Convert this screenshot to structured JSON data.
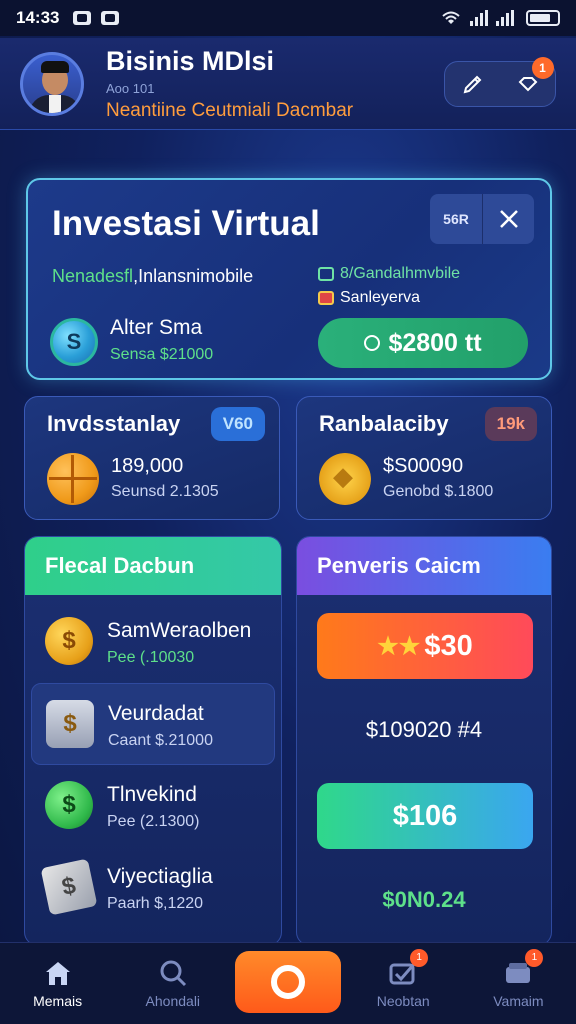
{
  "status_bar": {
    "time": "14:33"
  },
  "header": {
    "title": "Bisinis MDlsi",
    "subtitle": "Aoo 101",
    "tagline": "Neantiine Ceutmiali Dacmbar",
    "notification_count": "1"
  },
  "main_card": {
    "title": "Investasi Virtual",
    "btn_label": "56R",
    "line1_green": "Nenadesfl",
    "line1_white": ",Inlansnimobile",
    "right_line1": "8/Gandalhmvbile",
    "right_line2": "Sanleyerva",
    "item_title": "Alter Sma",
    "item_sub": "Sensa $21000",
    "amount": "$2800 tt",
    "colors": {
      "border": "#5fc8e8",
      "amount_bg": "#2ab07a"
    }
  },
  "mid_cards": [
    {
      "title": "Invdsstanlay",
      "badge": "V60",
      "value": "189,000",
      "sub": "Seunsd 2.1305"
    },
    {
      "title": "Ranbalaciby",
      "badge": "19k",
      "value": "$S00090",
      "sub": "Genobd $.1800"
    }
  ],
  "left_column": {
    "title": "Flecal Dacbun",
    "items": [
      {
        "title": "SamWeraolben",
        "sub": "Pee (.10030",
        "icon": "dollar-coin-icon"
      },
      {
        "title": "Veurdadat",
        "sub": "Caant $.21000",
        "icon": "wallet-icon"
      },
      {
        "title": "Tlnvekind",
        "sub": "Pee (2.1300)",
        "icon": "dollar-green-icon"
      },
      {
        "title": "Viyectiaglia",
        "sub": "Paarh $,1220",
        "icon": "cards-icon"
      }
    ]
  },
  "right_column": {
    "title": "Penveris Caicm",
    "reward1": "$30",
    "value1": "$109020 #4",
    "reward2": "$106",
    "value2": "$0N0.24"
  },
  "nav": {
    "items": [
      {
        "label": "Memais"
      },
      {
        "label": "Ahondali"
      },
      {
        "label": ""
      },
      {
        "label": "Neobtan",
        "badge": "1"
      },
      {
        "label": "Vamaim",
        "badge": "1"
      }
    ]
  }
}
